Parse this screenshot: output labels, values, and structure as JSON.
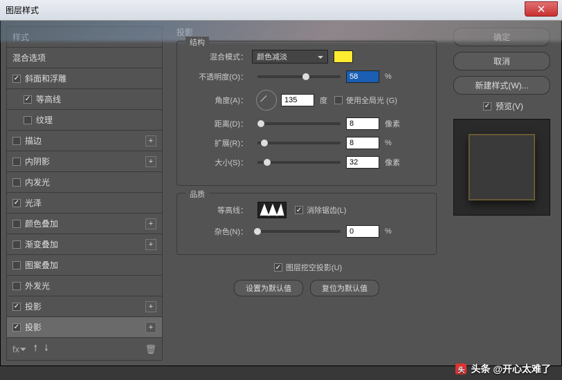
{
  "title": "图层样式",
  "left": {
    "header": "样式",
    "sub": "混合选项",
    "items": [
      {
        "label": "斜面和浮雕",
        "checked": true,
        "indent": false,
        "plus": false
      },
      {
        "label": "等高线",
        "checked": true,
        "indent": true,
        "plus": false
      },
      {
        "label": "纹理",
        "checked": false,
        "indent": true,
        "plus": false
      },
      {
        "label": "描边",
        "checked": false,
        "indent": false,
        "plus": true
      },
      {
        "label": "内阴影",
        "checked": false,
        "indent": false,
        "plus": true
      },
      {
        "label": "内发光",
        "checked": false,
        "indent": false,
        "plus": false
      },
      {
        "label": "光泽",
        "checked": true,
        "indent": false,
        "plus": false
      },
      {
        "label": "颜色叠加",
        "checked": false,
        "indent": false,
        "plus": true
      },
      {
        "label": "渐变叠加",
        "checked": false,
        "indent": false,
        "plus": true
      },
      {
        "label": "图案叠加",
        "checked": false,
        "indent": false,
        "plus": false
      },
      {
        "label": "外发光",
        "checked": false,
        "indent": false,
        "plus": false
      },
      {
        "label": "投影",
        "checked": true,
        "indent": false,
        "plus": true
      },
      {
        "label": "投影",
        "checked": true,
        "indent": false,
        "plus": true,
        "selected": true
      }
    ]
  },
  "center": {
    "title": "投影",
    "structure": {
      "legend": "结构",
      "blend_mode_label": "混合模式：",
      "blend_mode_value": "颜色减淡",
      "color": "#ffec30",
      "opacity_label": "不透明度(O)：",
      "opacity_value": "58",
      "opacity_unit": "%",
      "angle_label": "角度(A)：",
      "angle_value": "135",
      "angle_unit": "度",
      "global_light": "使用全局光 (G)",
      "distance_label": "距离(D)：",
      "distance_value": "8",
      "distance_unit": "像素",
      "spread_label": "扩展(R)：",
      "spread_value": "8",
      "spread_unit": "%",
      "size_label": "大小(S)：",
      "size_value": "32",
      "size_unit": "像素"
    },
    "quality": {
      "legend": "品质",
      "contour_label": "等高线：",
      "antialias": "消除锯齿(L)",
      "noise_label": "杂色(N)：",
      "noise_value": "0",
      "noise_unit": "%"
    },
    "knockout": "图层挖空投影(U)",
    "set_default": "设置为默认值",
    "reset_default": "复位为默认值"
  },
  "right": {
    "ok": "确定",
    "cancel": "取消",
    "new_style": "新建样式(W)...",
    "preview": "预览(V)"
  },
  "watermark": "头条 @开心太难了"
}
